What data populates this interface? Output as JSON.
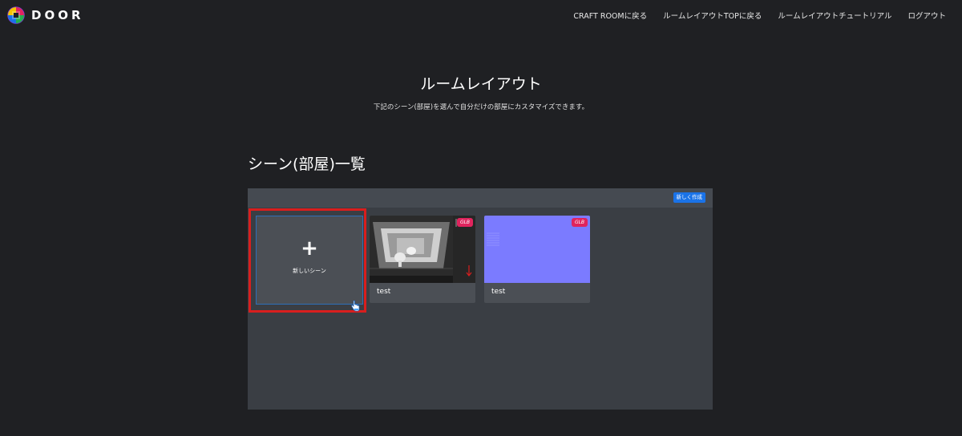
{
  "header": {
    "logo_text": "DOOR",
    "nav": [
      {
        "label": "CRAFT ROOMに戻る"
      },
      {
        "label": "ルームレイアウトTOPに戻る"
      },
      {
        "label": "ルームレイアウトチュートリアル"
      },
      {
        "label": "ログアウト"
      }
    ]
  },
  "main": {
    "title": "ルームレイアウト",
    "subtitle": "下記のシーン(部屋)を選んで自分だけの部屋にカスタマイズできます。",
    "section_title": "シーン(部屋)一覧",
    "create_button": "新しく作成",
    "new_scene": {
      "icon": "plus-icon",
      "plus_glyph": "+",
      "label": "新しいシーン"
    },
    "scenes": [
      {
        "name": "test",
        "badge": "GLB",
        "thumbnail": "3d-room-render"
      },
      {
        "name": "test",
        "badge": "GLB",
        "thumbnail": "blue-solid"
      }
    ]
  },
  "colors": {
    "background": "#1f2023",
    "panel": "#3a3e44",
    "card": "#4b4f55",
    "accent_blue": "#1a73e8",
    "badge_pink": "#e0245e",
    "highlight_red": "#d81e1e",
    "thumb_blue": "#7b7bff"
  }
}
